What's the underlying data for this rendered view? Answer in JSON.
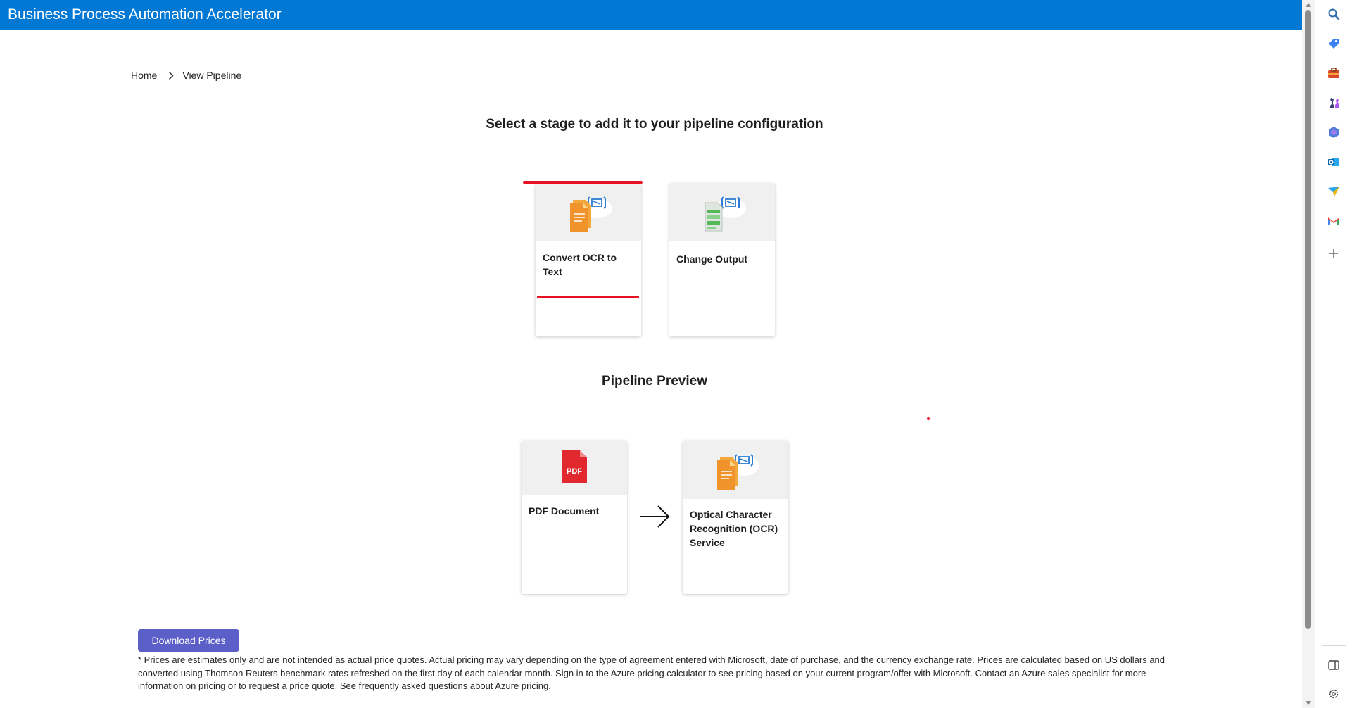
{
  "header": {
    "title": "Business Process Automation Accelerator"
  },
  "breadcrumb": {
    "home": "Home",
    "current": "View Pipeline"
  },
  "stages": {
    "heading": "Select a stage to add it to your pipeline configuration",
    "items": [
      {
        "label": "Convert OCR to Text",
        "icon": "document-code-icon",
        "selected": true
      },
      {
        "label": "Change Output",
        "icon": "document-transform-icon",
        "selected": false
      }
    ]
  },
  "preview": {
    "heading": "Pipeline Preview",
    "items": [
      {
        "label": "PDF Document",
        "icon": "pdf-icon",
        "badge": "PDF"
      },
      {
        "label": "Optical Character Recognition (OCR) Service",
        "icon": "document-code-icon"
      }
    ]
  },
  "download": {
    "label": "Download Prices"
  },
  "disclaimer": "* Prices are estimates only and are not intended as actual price quotes. Actual pricing may vary depending on the type of agreement entered with Microsoft, date of purchase, and the currency exchange rate. Prices are calculated based on US dollars and converted using Thomson Reuters benchmark rates refreshed on the first day of each calendar month. Sign in to the Azure pricing calculator to see pricing based on your current program/offer with Microsoft. Contact an Azure sales specialist for more information on pricing or to request a price quote. See frequently asked questions about Azure pricing.",
  "sidebar": {
    "icons": [
      "search-icon",
      "tag-icon",
      "briefcase-icon",
      "chess-icon",
      "copilot-icon",
      "outlook-icon",
      "send-icon",
      "gmail-icon",
      "add-icon",
      "sidebar-toggle-icon",
      "settings-icon"
    ]
  },
  "colors": {
    "header_bg": "#0078d4",
    "selection_accent": "#e81123",
    "button_bg": "#5b5fc7",
    "ocr_orange": "#f0932b",
    "pdf_red": "#e0282e"
  }
}
